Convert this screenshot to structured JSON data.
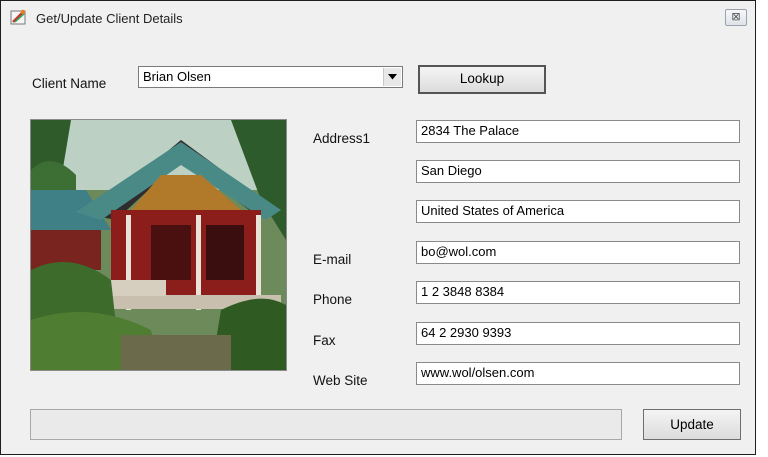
{
  "window": {
    "title": "Get/Update Client Details",
    "close_glyph": "⊠"
  },
  "client": {
    "label": "Client Name",
    "selected": "Brian Olsen",
    "lookup_label": "Lookup"
  },
  "address": {
    "label": "Address1",
    "line1": "2834 The Palace",
    "line2": "San Diego",
    "line3": "United States of America"
  },
  "email": {
    "label": "E-mail",
    "value": "bo@wol.com"
  },
  "phone": {
    "label": "Phone",
    "value": "1 2 3848 8384"
  },
  "fax": {
    "label": "Fax",
    "value": "64 2 2930 9393"
  },
  "website": {
    "label": "Web Site",
    "value": "www.wol/olsen.com"
  },
  "actions": {
    "update_label": "Update"
  },
  "colors": {
    "window_bg": "#f0f0f0",
    "roof": "#4a8a86",
    "house_wall": "#8b1e1a",
    "foliage": "#3c6b2c"
  },
  "icons": {
    "app": "app-icon",
    "dropdown": "chevron-down-icon",
    "close": "close-icon"
  }
}
